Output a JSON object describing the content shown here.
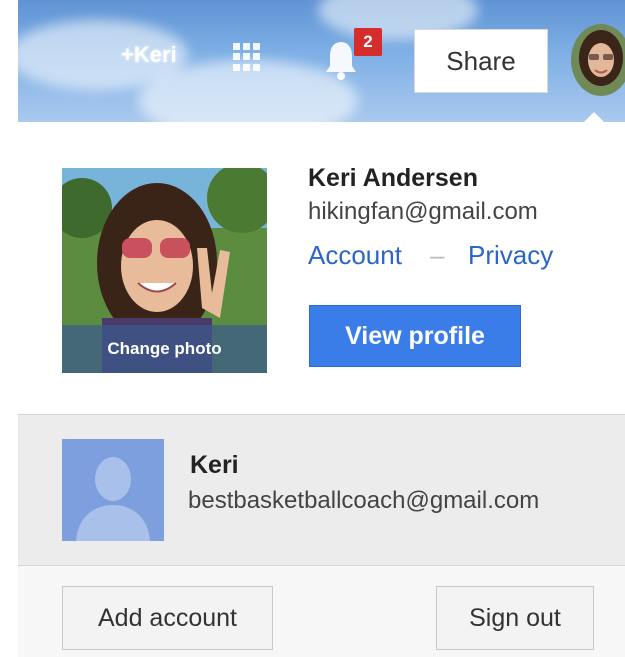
{
  "topbar": {
    "plus_name": "+Keri",
    "apps_icon": "apps-grid-icon",
    "bell_icon": "bell-icon",
    "notification_count": "2",
    "share_label": "Share",
    "avatar": "user-avatar"
  },
  "account": {
    "photo": "profile-photo",
    "change_photo_label": "Change photo",
    "name": "Keri Andersen",
    "email": "hikingfan@gmail.com",
    "account_link": "Account",
    "separator": "–",
    "privacy_link": "Privacy",
    "view_profile_label": "View profile"
  },
  "other_account": {
    "avatar": "default-avatar-icon",
    "name": "Keri",
    "email": "bestbasketballcoach@gmail.com"
  },
  "footer": {
    "add_account_label": "Add account",
    "sign_out_label": "Sign out"
  },
  "colors": {
    "accent": "#3b7de8",
    "link": "#2a66c8",
    "badge": "#d52c2c",
    "topbar": "#7fb0e6"
  }
}
